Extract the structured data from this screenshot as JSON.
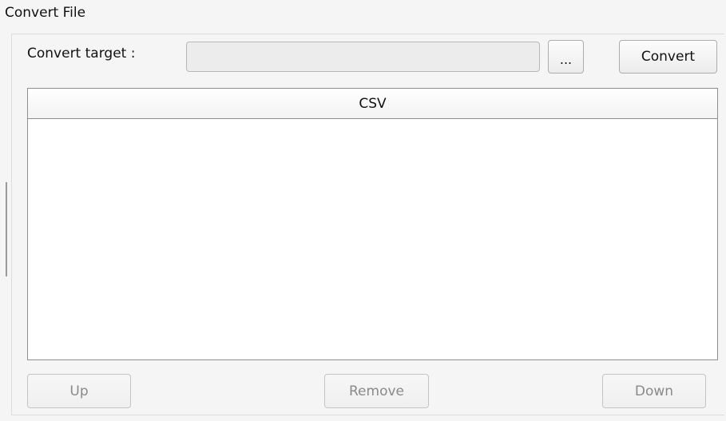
{
  "group": {
    "title": "Convert File"
  },
  "target": {
    "label": "Convert target :",
    "value": ""
  },
  "toolbar": {
    "browse_label": "...",
    "convert_label": "Convert"
  },
  "list": {
    "header": "CSV",
    "items": []
  },
  "actions": {
    "up_label": "Up",
    "remove_label": "Remove",
    "down_label": "Down"
  }
}
